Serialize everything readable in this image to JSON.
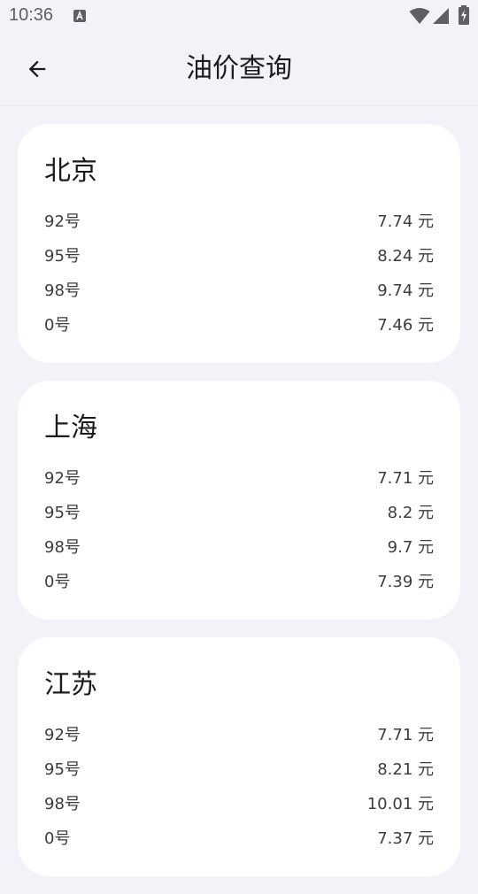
{
  "status_bar": {
    "time": "10:36"
  },
  "header": {
    "title": "油价查询"
  },
  "cards": [
    {
      "province": "北京",
      "rows": [
        {
          "label": "92号",
          "value": "7.74 元"
        },
        {
          "label": "95号",
          "value": "8.24 元"
        },
        {
          "label": "98号",
          "value": "9.74 元"
        },
        {
          "label": "0号",
          "value": "7.46 元"
        }
      ]
    },
    {
      "province": "上海",
      "rows": [
        {
          "label": "92号",
          "value": "7.71 元"
        },
        {
          "label": "95号",
          "value": "8.2 元"
        },
        {
          "label": "98号",
          "value": "9.7 元"
        },
        {
          "label": "0号",
          "value": "7.39 元"
        }
      ]
    },
    {
      "province": "江苏",
      "rows": [
        {
          "label": "92号",
          "value": "7.71 元"
        },
        {
          "label": "95号",
          "value": "8.21 元"
        },
        {
          "label": "98号",
          "value": "10.01 元"
        },
        {
          "label": "0号",
          "value": "7.37 元"
        }
      ]
    }
  ]
}
